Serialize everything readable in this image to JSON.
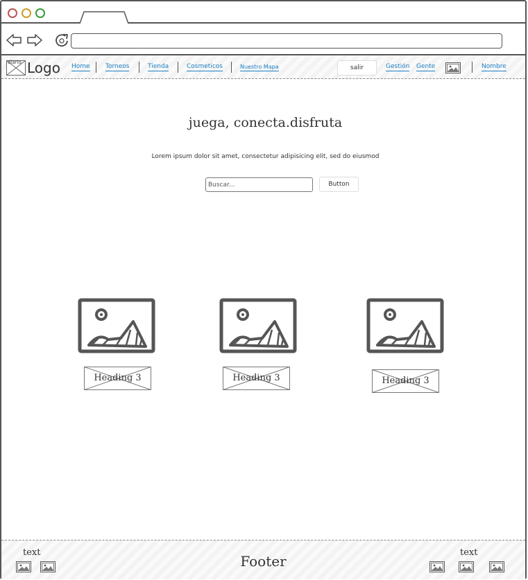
{
  "browser": {
    "url_value": ""
  },
  "header": {
    "logo_image_label": "diario",
    "logo_text": "Logo",
    "nav_links": [
      {
        "label": "Home"
      },
      {
        "label": "Torneos"
      },
      {
        "label": "Tienda"
      },
      {
        "label": "Cosmeticos"
      },
      {
        "label": "Nuestro Mapa"
      }
    ],
    "salir_label": "salir",
    "right_links": [
      {
        "label": "Gestión"
      },
      {
        "label": "Gente"
      }
    ],
    "user_name": "Nombre"
  },
  "main": {
    "title": "juega, conecta.disfruta",
    "subtitle": "Lorem ipsum dolor sit amet, consectetur adipisicing elit, sed do eiusmod",
    "search": {
      "placeholder": "Buscar...",
      "button_label": "Button"
    },
    "cards": [
      {
        "heading": "Heading 3",
        "icon": "image-icon"
      },
      {
        "heading": "Heading 3",
        "icon": "image-icon"
      },
      {
        "heading": "Heading 3",
        "icon": "image-icon"
      }
    ]
  },
  "footer": {
    "title": "Footer",
    "left_text": "text",
    "right_text": "text"
  },
  "colors": {
    "link": "#1b7ec2",
    "border": "#555555",
    "close_dot": "#b85555",
    "minimize_dot": "#d09a2a",
    "maximize_dot": "#3a9a3a"
  }
}
